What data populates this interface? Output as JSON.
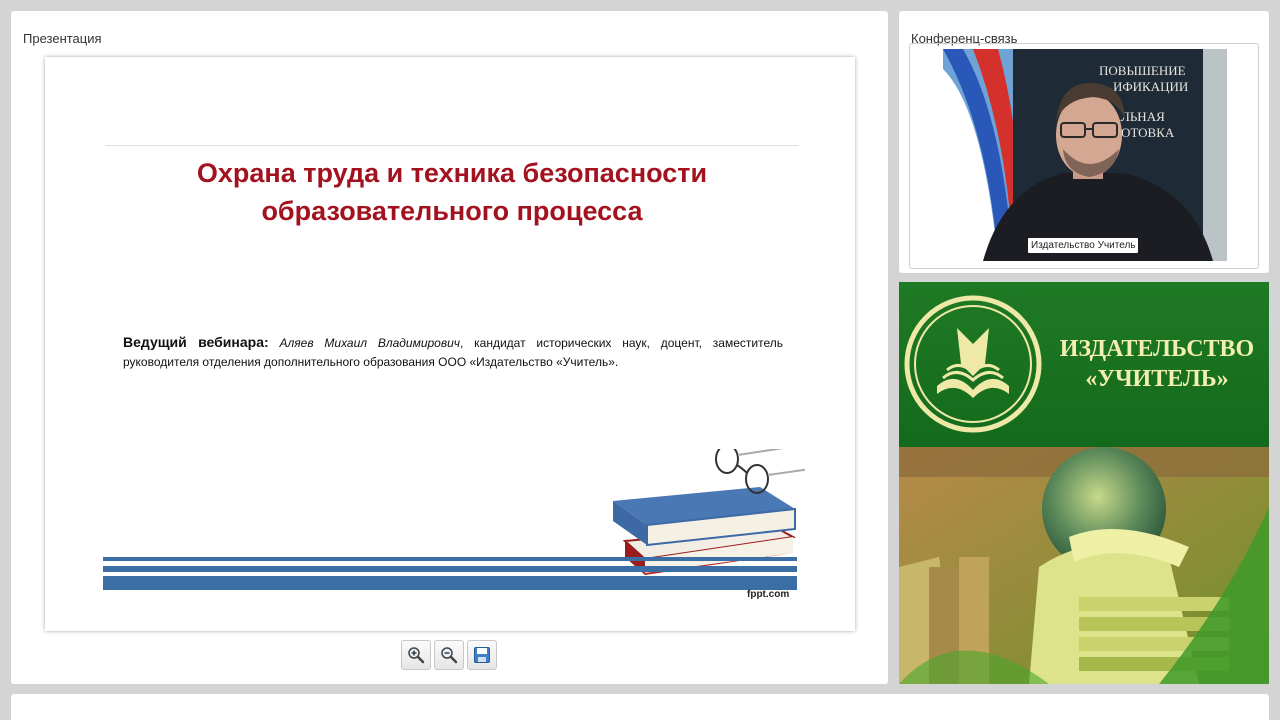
{
  "presentation_panel": {
    "title": "Презентация",
    "slide": {
      "title_line1": "Охрана труда и техника безопасности",
      "title_line2": "образовательного процесса",
      "host_label": "Ведущий вебинара:",
      "host_name": "Аляев Михаил Владимирович",
      "host_details": ", кандидат исторических наук, доцент, заместитель руководителя отделения дополнительного образования ООО «Издательство «Учитель».",
      "watermark": "fppt.com"
    },
    "tools": {
      "zoom_in_icon": "zoom-in-icon",
      "zoom_out_icon": "zoom-out-icon",
      "save_icon": "save-icon"
    }
  },
  "conference_panel": {
    "title": "Конференц-связь",
    "video_name_tag": "Издательство Учитель",
    "backdrop_text": [
      "ПОВЫШЕНИЕ",
      "ИФИКАЦИИ",
      "П    АЛЬНАЯ",
      "ОТОВКА"
    ]
  },
  "brand": {
    "line1": "ИЗДАТЕЛЬСТВО",
    "line2": "«УЧИТЕЛЬ»",
    "colors": {
      "green": "#1f7a24",
      "gold": "#f3efb0"
    }
  },
  "colors": {
    "slide_title": "#a3121f",
    "stripe_blue": "#3a6ea5"
  }
}
